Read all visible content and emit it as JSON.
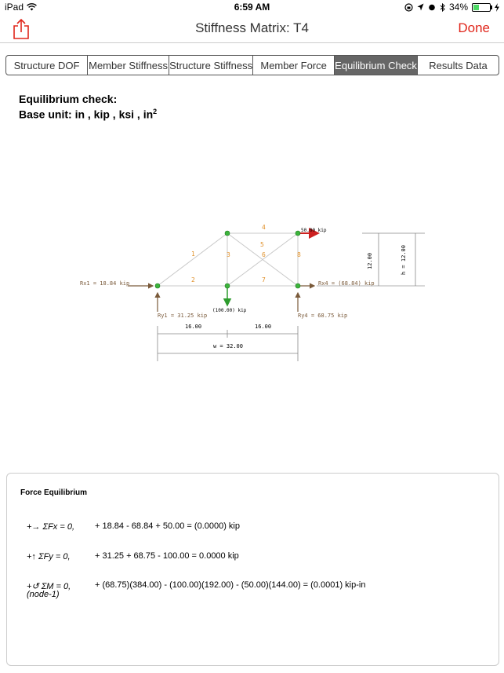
{
  "status": {
    "device": "iPad",
    "time": "6:59 AM",
    "battery": "34%",
    "battery_level": 0.34
  },
  "nav": {
    "title": "Stiffness Matrix: T4",
    "done": "Done"
  },
  "tabs": [
    {
      "label": "Structure DOF",
      "active": false
    },
    {
      "label": "Member Stiffness",
      "active": false
    },
    {
      "label": "Structure Stiffness",
      "active": false
    },
    {
      "label": "Member Force",
      "active": false
    },
    {
      "label": "Equilibrium Check",
      "active": true
    },
    {
      "label": "Results Data",
      "active": false
    }
  ],
  "heading": {
    "line1": "Equilibrium check:",
    "line2_prefix": "Base unit: in , kip , ksi , in",
    "line2_sup": "2"
  },
  "diagram": {
    "members": [
      "1",
      "2",
      "3",
      "4",
      "5",
      "6",
      "7",
      "8"
    ],
    "loads": {
      "top": "50.00 kip",
      "bottom": "(100.00) kip"
    },
    "reactions": {
      "rx1": "Rx1 = 18.84 kip",
      "ry1": "Ry1 = 31.25 kip",
      "ry4": "Ry4 = 68.75 kip",
      "rx4": "Rx4 = (68.84) kip"
    },
    "dims": {
      "span1": "16.00",
      "span2": "16.00",
      "width": "w = 32.00",
      "height_left": "12.00",
      "height_right": "h = 12.00"
    }
  },
  "colors": {
    "accent": "#e0261b",
    "member": "#c8c8c8",
    "label_orange": "#e0902a",
    "node_green": "#3cb43c",
    "reaction_brown": "#7a5a3a"
  },
  "equilibrium": {
    "title": "Force Equilibrium",
    "fx": {
      "label": "+→ ΣFx = 0,",
      "value": "+ 18.84 - 68.84 + 50.00 = (0.0000) kip"
    },
    "fy": {
      "label": "+↑ ΣFy = 0,",
      "value": "+ 31.25 + 68.75 - 100.00 = 0.0000 kip"
    },
    "m": {
      "label": "+↺ ΣM = 0,",
      "sub": "(node-1)",
      "value": "+ (68.75)(384.00) - (100.00)(192.00) - (50.00)(144.00) = (0.0001) kip-in"
    }
  }
}
